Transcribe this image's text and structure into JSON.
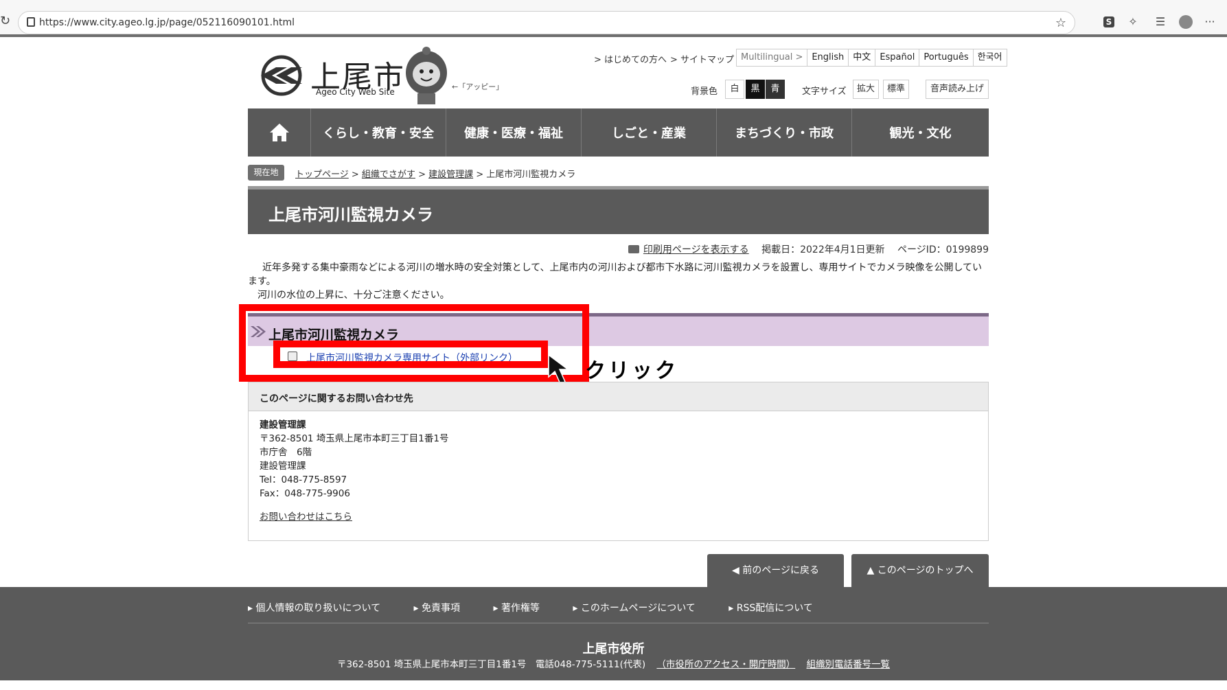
{
  "browser": {
    "url": "https://www.city.ageo.lg.jp/page/052116090101.html",
    "s_badge": "S",
    "more": "···"
  },
  "header": {
    "logo_title": "上尾市",
    "logo_sub": "Ageo City Web Site",
    "mascot_label": "←「アッピー」",
    "link_first_time": "> はじめての方へ",
    "link_sitemap": "> サイトマップ",
    "languages": [
      "Multilingual >",
      "English",
      "中文",
      "Español",
      "Português",
      "한국어"
    ],
    "bg_label": "背景色",
    "bg_white": "白",
    "bg_black": "黒",
    "bg_blue": "青",
    "font_label": "文字サイズ",
    "font_large": "拡大",
    "font_normal": "標準",
    "speech": "音声読み上げ"
  },
  "nav": {
    "items": [
      "くらし・教育・安全",
      "健康・医療・福祉",
      "しごと・産業",
      "まちづくり・市政",
      "観光・文化"
    ]
  },
  "breadcrumb": {
    "badge": "現在地",
    "items": [
      "トップページ",
      "組織でさがす",
      "建設管理課"
    ],
    "current": "上尾市河川監視カメラ",
    "sep": " > "
  },
  "page": {
    "title": "上尾市河川監視カメラ",
    "print_link": "印刷用ページを表示する",
    "published": "掲載日：2022年4月1日更新",
    "page_id": "ページID：0199899",
    "intro": "近年多発する集中豪雨などによる河川の増水時の安全対策として、上尾市内の河川および都市下水路に河川監視カメラを設置し、専用サイトでカメラ映像を公開しています。",
    "notice": "河川の水位の上昇に、十分ご注意ください。"
  },
  "section": {
    "title": "上尾市河川監視カメラ",
    "link": "上尾市河川監視カメラ専用サイト（外部リンク）"
  },
  "annotation": {
    "click": "クリック"
  },
  "contact": {
    "heading": "このページに関するお問い合わせ先",
    "dept": "建設管理課",
    "address": "〒362-8501 埼玉県上尾市本町三丁目1番1号",
    "floor": "市庁舎　6階",
    "dept2": "建設管理課",
    "tel": "Tel：048-775-8597",
    "fax": "Fax：048-775-9906",
    "inquiry_link": "お問い合わせはこちら"
  },
  "page_nav": {
    "back": "前のページに戻る",
    "top": "このページのトップへ"
  },
  "footer": {
    "links": [
      "個人情報の取り扱いについて",
      "免責事項",
      "著作権等",
      "このホームページについて",
      "RSS配信について"
    ],
    "name": "上尾市役所",
    "address": "〒362-8501 埼玉県上尾市本町三丁目1番1号　電話048-775-5111(代表)",
    "access_link": "（市役所のアクセス・開庁時間）",
    "phone_list_link": "組織別電話番号一覧"
  },
  "colors": {
    "nav_bg": "#595959",
    "section_bg": "#ddc9e3",
    "annotation_red": "#ff0000",
    "link_blue": "#1a3fb0"
  }
}
